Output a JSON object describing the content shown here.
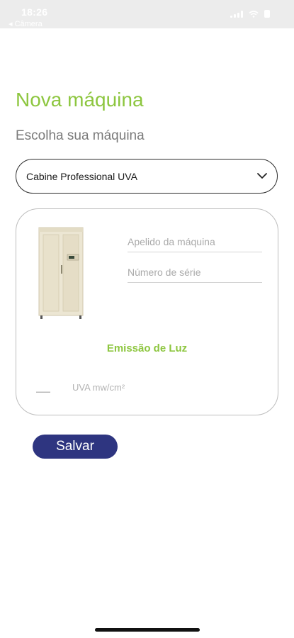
{
  "status_bar": {
    "time": "18:26",
    "back_label": "◂ Câmera",
    "icons": [
      "signal-icon",
      "wifi-icon",
      "battery-icon"
    ]
  },
  "page": {
    "title": "Nova máquina",
    "subtitle": "Escolha sua máquina"
  },
  "machine_select": {
    "selected": "Cabine Professional UVA",
    "icon": "chevron-down-icon"
  },
  "card": {
    "nickname_placeholder": "Apelido da máquina",
    "serial_placeholder": "Número de série",
    "emission_title": "Emissão de Luz",
    "uva_placeholder": "UVA mw/cm²"
  },
  "actions": {
    "save_label": "Salvar"
  },
  "colors": {
    "accent_green": "#8dc63f",
    "button_navy": "#2e3580"
  }
}
